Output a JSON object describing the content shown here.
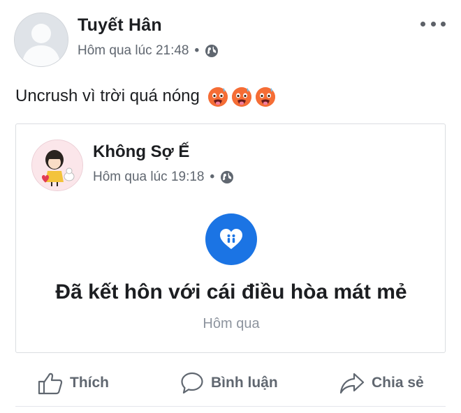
{
  "post": {
    "author": "Tuyết Hân",
    "timestamp": "Hôm qua lúc 21:48",
    "separator": "•",
    "privacy_icon": "globe-icon",
    "status_text": "Uncrush vì trời quá nóng",
    "emojis": [
      "hot-face-emoji",
      "hot-face-emoji",
      "hot-face-emoji"
    ]
  },
  "shared": {
    "author": "Không Sợ Ế",
    "timestamp": "Hôm qua lúc 19:18",
    "separator": "•",
    "privacy_icon": "globe-icon",
    "event_icon": "heart-icon",
    "event_title": "Đã kết hôn với cái điều hòa mát mẻ",
    "event_date": "Hôm qua"
  },
  "actions": {
    "like": "Thích",
    "comment": "Bình luận",
    "share": "Chia sẻ"
  },
  "colors": {
    "accent": "#1b74e4",
    "text": "#1c1e21",
    "muted": "#606770"
  }
}
